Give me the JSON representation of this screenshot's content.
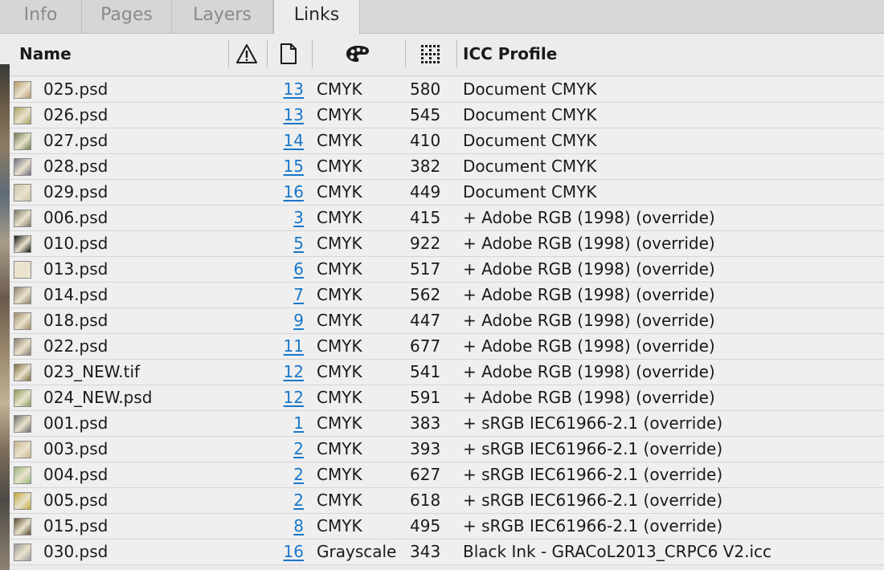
{
  "tabs": [
    {
      "label": "Info",
      "active": false
    },
    {
      "label": "Pages",
      "active": false
    },
    {
      "label": "Layers",
      "active": false
    },
    {
      "label": "Links",
      "active": true
    }
  ],
  "columns": {
    "name": "Name",
    "status_icon": "warning-icon",
    "page_icon": "page-icon",
    "color_icon": "color-palette-icon",
    "ppi_icon": "resolution-grid-icon",
    "icc": "ICC Profile"
  },
  "rows": [
    {
      "name": "025.psd",
      "page": "13",
      "color": "CMYK",
      "ppi": "580",
      "icc": "Document CMYK",
      "thumb": "#b79a6a"
    },
    {
      "name": "026.psd",
      "page": "13",
      "color": "CMYK",
      "ppi": "545",
      "icc": "Document CMYK",
      "thumb": "#a8a15e"
    },
    {
      "name": "027.psd",
      "page": "14",
      "color": "CMYK",
      "ppi": "410",
      "icc": "Document CMYK",
      "thumb": "#6e7a52"
    },
    {
      "name": "028.psd",
      "page": "15",
      "color": "CMYK",
      "ppi": "382",
      "icc": "Document CMYK",
      "thumb": "#6f6a86"
    },
    {
      "name": "029.psd",
      "page": "16",
      "color": "CMYK",
      "ppi": "449",
      "icc": "Document CMYK",
      "thumb": "#c9c3a8"
    },
    {
      "name": "006.psd",
      "page": "3",
      "color": "CMYK",
      "ppi": "415",
      "icc": "+ Adobe RGB (1998) (override)",
      "thumb": "#7b7766"
    },
    {
      "name": "010.psd",
      "page": "5",
      "color": "CMYK",
      "ppi": "922",
      "icc": "+ Adobe RGB (1998) (override)",
      "thumb": "#141414"
    },
    {
      "name": "013.psd",
      "page": "6",
      "color": "CMYK",
      "ppi": "517",
      "icc": "+ Adobe RGB (1998) (override)",
      "thumb": "#efe8d2"
    },
    {
      "name": "014.psd",
      "page": "7",
      "color": "CMYK",
      "ppi": "562",
      "icc": "+ Adobe RGB (1998) (override)",
      "thumb": "#8f7f6a"
    },
    {
      "name": "018.psd",
      "page": "9",
      "color": "CMYK",
      "ppi": "447",
      "icc": "+ Adobe RGB (1998) (override)",
      "thumb": "#a08a63"
    },
    {
      "name": "022.psd",
      "page": "11",
      "color": "CMYK",
      "ppi": "677",
      "icc": "+ Adobe RGB (1998) (override)",
      "thumb": "#8a7b70"
    },
    {
      "name": "023_NEW.tif",
      "page": "12",
      "color": "CMYK",
      "ppi": "541",
      "icc": "+ Adobe RGB (1998) (override)",
      "thumb": "#7b6a3e"
    },
    {
      "name": "024_NEW.psd",
      "page": "12",
      "color": "CMYK",
      "ppi": "591",
      "icc": "+ Adobe RGB (1998) (override)",
      "thumb": "#8a9a5a"
    },
    {
      "name": "001.psd",
      "page": "1",
      "color": "CMYK",
      "ppi": "383",
      "icc": "+ sRGB IEC61966-2.1 (override)",
      "thumb": "#6b6b6b"
    },
    {
      "name": "003.psd",
      "page": "2",
      "color": "CMYK",
      "ppi": "393",
      "icc": "+ sRGB IEC61966-2.1 (override)",
      "thumb": "#c9b48a"
    },
    {
      "name": "004.psd",
      "page": "2",
      "color": "CMYK",
      "ppi": "627",
      "icc": "+ sRGB IEC61966-2.1 (override)",
      "thumb": "#9ab57a"
    },
    {
      "name": "005.psd",
      "page": "2",
      "color": "CMYK",
      "ppi": "618",
      "icc": "+ sRGB IEC61966-2.1 (override)",
      "thumb": "#c4a83a"
    },
    {
      "name": "015.psd",
      "page": "8",
      "color": "CMYK",
      "ppi": "495",
      "icc": "+ sRGB IEC61966-2.1 (override)",
      "thumb": "#5a4a2e"
    },
    {
      "name": "030.psd",
      "page": "16",
      "color": "Grayscale",
      "ppi": "343",
      "icc": "Black Ink - GRACoL2013_CRPC6 V2.icc",
      "thumb": "#9a9a9a"
    }
  ],
  "colors": {
    "link": "#1877c9",
    "panel": "#efefef",
    "header": "#ececec"
  }
}
